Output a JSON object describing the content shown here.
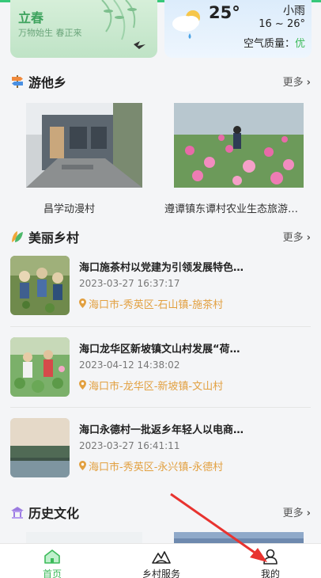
{
  "solar_term": {
    "title": "立春",
    "subtitle": "万物始生 春正来"
  },
  "weather": {
    "temperature": "25°",
    "condition": "小雨",
    "range": "16 ~ 26°",
    "air_quality_label": "空气质量：",
    "air_quality_value": "优"
  },
  "sections": {
    "tour": {
      "title": "游他乡",
      "more": "更多"
    },
    "village": {
      "title": "美丽乡村",
      "more": "更多"
    },
    "history": {
      "title": "历史文化",
      "more": "更多"
    }
  },
  "tour_cards": [
    {
      "caption": "昌学动漫村"
    },
    {
      "caption": "遵谭镇东谭村农业生态旅游…"
    }
  ],
  "villages": [
    {
      "title": "海口施茶村以党建为引领发展特色…",
      "time": "2023-03-27 16:37:17",
      "location": "海口市-秀英区-石山镇-施茶村"
    },
    {
      "title": "海口龙华区新坡镇文山村发展“荷…",
      "time": "2023-04-12 14:38:02",
      "location": "海口市-龙华区-新坡镇-文山村"
    },
    {
      "title": "海口永德村一批返乡年轻人以电商…",
      "time": "2023-03-27 16:41:11",
      "location": "海口市-秀英区-永兴镇-永德村"
    }
  ],
  "tabs": [
    {
      "label": "首页",
      "icon": "home-icon",
      "active": true
    },
    {
      "label": "乡村服务",
      "icon": "mountain-icon",
      "active": false
    },
    {
      "label": "我的",
      "icon": "person-icon",
      "active": false
    }
  ],
  "colors": {
    "accent": "#3cbb5a",
    "location": "#e2a040",
    "annotation": "#e8332f"
  }
}
